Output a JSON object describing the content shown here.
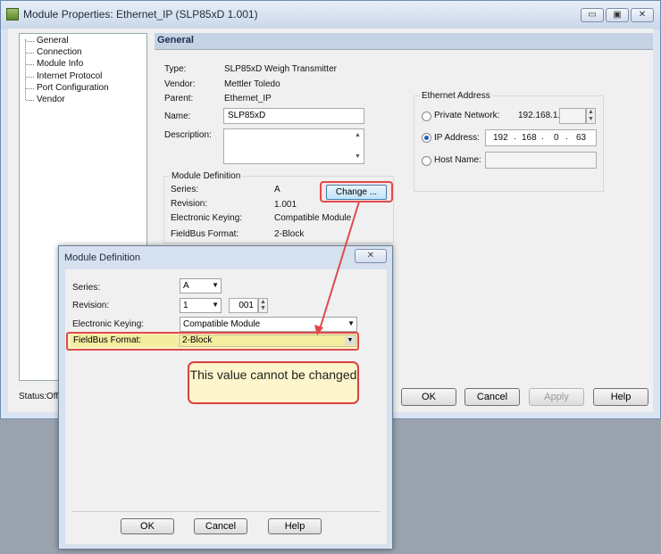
{
  "window": {
    "title": "Module Properties: Ethernet_IP (SLP85xD 1.001)",
    "min": "▭",
    "max": "▣",
    "close": "✕"
  },
  "tree": {
    "items": [
      "General",
      "Connection",
      "Module Info",
      "Internet Protocol",
      "Port Configuration",
      "Vendor"
    ]
  },
  "panel": {
    "heading": "General",
    "type_label": "Type:",
    "type_value": "SLP85xD Weigh Transmitter",
    "vendor_label": "Vendor:",
    "vendor_value": "Mettler Toledo",
    "parent_label": "Parent:",
    "parent_value": "Ethernet_IP",
    "name_label": "Name:",
    "name_value": "SLP85xD",
    "description_label": "Description:",
    "description_value": ""
  },
  "module_definition": {
    "title": "Module Definition",
    "series_label": "Series:",
    "series_value": "A",
    "revision_label": "Revision:",
    "revision_value": "1.001",
    "keying_label": "Electronic Keying:",
    "keying_value": "Compatible Module",
    "fieldbus_label": "FieldBus Format:",
    "fieldbus_value": "2-Block",
    "change_button": "Change ..."
  },
  "ethernet": {
    "title": "Ethernet Address",
    "private_label": "Private Network:",
    "private_prefix": "192.168.1.",
    "ip_label": "IP Address:",
    "ip": [
      "192",
      "168",
      "0",
      "63"
    ],
    "host_label": "Host Name:",
    "selected": "ip"
  },
  "status": {
    "label": "Status:",
    "value": "Offl"
  },
  "buttons": {
    "ok": "OK",
    "cancel": "Cancel",
    "apply": "Apply",
    "help": "Help"
  },
  "dialog": {
    "title": "Module Definition",
    "close": "✕",
    "series_label": "Series:",
    "series_value": "A",
    "revision_label": "Revision:",
    "revision_major": "1",
    "revision_minor": "001",
    "keying_label": "Electronic Keying:",
    "keying_value": "Compatible Module",
    "fieldbus_label": "FieldBus Format:",
    "fieldbus_value": "2-Block",
    "ok": "OK",
    "cancel": "Cancel",
    "help": "Help"
  },
  "callout": {
    "text": "This value cannot be changed"
  },
  "colors": {
    "highlight_red": "#e04a4a",
    "callout_fill": "#fdf6cc",
    "title_bar": "#dbe5f1"
  }
}
